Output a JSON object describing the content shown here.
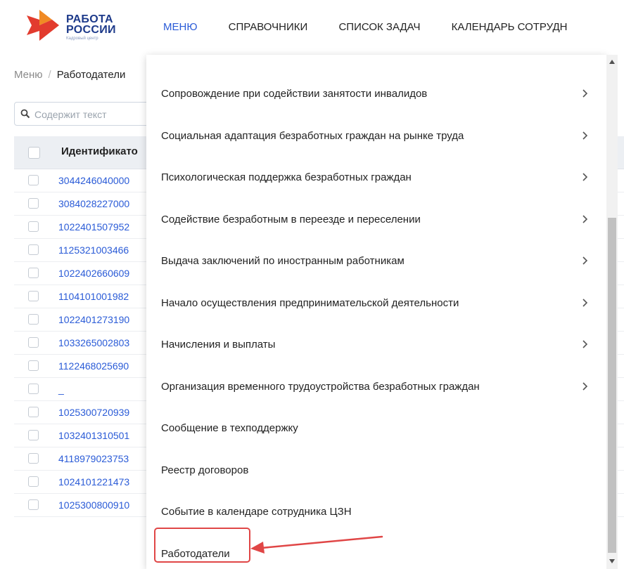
{
  "logo": {
    "line1": "РАБОТА",
    "line2": "РОССИИ",
    "sub": "Кадровый центр"
  },
  "nav": [
    "МЕНЮ",
    "СПРАВОЧНИКИ",
    "СПИСОК ЗАДАЧ",
    "КАЛЕНДАРЬ СОТРУДН"
  ],
  "breadcrumb": {
    "root": "Меню",
    "sep": "/",
    "current": "Работодатели"
  },
  "search": {
    "placeholder": "Содержит текст"
  },
  "table": {
    "header_id": "Идентификато",
    "rows": [
      "3044246040000",
      "3084028227000",
      "1022401507952",
      "1125321003466",
      "1022402660609",
      "1104101001982",
      "1022401273190",
      "1033265002803",
      "1122468025690",
      "_",
      "1025300720939",
      "1032401310501",
      "4118979023753",
      "1024101221473",
      "1025300800910"
    ]
  },
  "menu": [
    {
      "label": "Сопровождение при содействии занятости инвалидов",
      "submenu": true
    },
    {
      "label": "Социальная адаптация безработных граждан на рынке труда",
      "submenu": true
    },
    {
      "label": "Психологическая поддержка безработных граждан",
      "submenu": true
    },
    {
      "label": "Содействие безработным в переезде и переселении",
      "submenu": true
    },
    {
      "label": "Выдача заключений по иностранным работникам",
      "submenu": true
    },
    {
      "label": "Начало осуществления предпринимательской деятельности",
      "submenu": true
    },
    {
      "label": "Начисления и выплаты",
      "submenu": true
    },
    {
      "label": "Организация временного трудоустройства безработных граждан",
      "submenu": true
    },
    {
      "label": "Сообщение в техподдержку",
      "submenu": false
    },
    {
      "label": "Реестр договоров",
      "submenu": false
    },
    {
      "label": "Событие в календаре сотрудника ЦЗН",
      "submenu": false
    },
    {
      "label": "Работодатели",
      "submenu": false
    }
  ],
  "colors": {
    "accent": "#2a5bd7",
    "highlight": "#e04646",
    "logo_red": "#e23b2e",
    "logo_blue": "#1d3a8a"
  },
  "icons": {
    "search": "search-icon",
    "chevron": "chevron-right-icon",
    "arrow": "arrow-left-icon"
  },
  "scrollbar": {
    "position": 0.43,
    "visible_fraction": 0.65
  }
}
